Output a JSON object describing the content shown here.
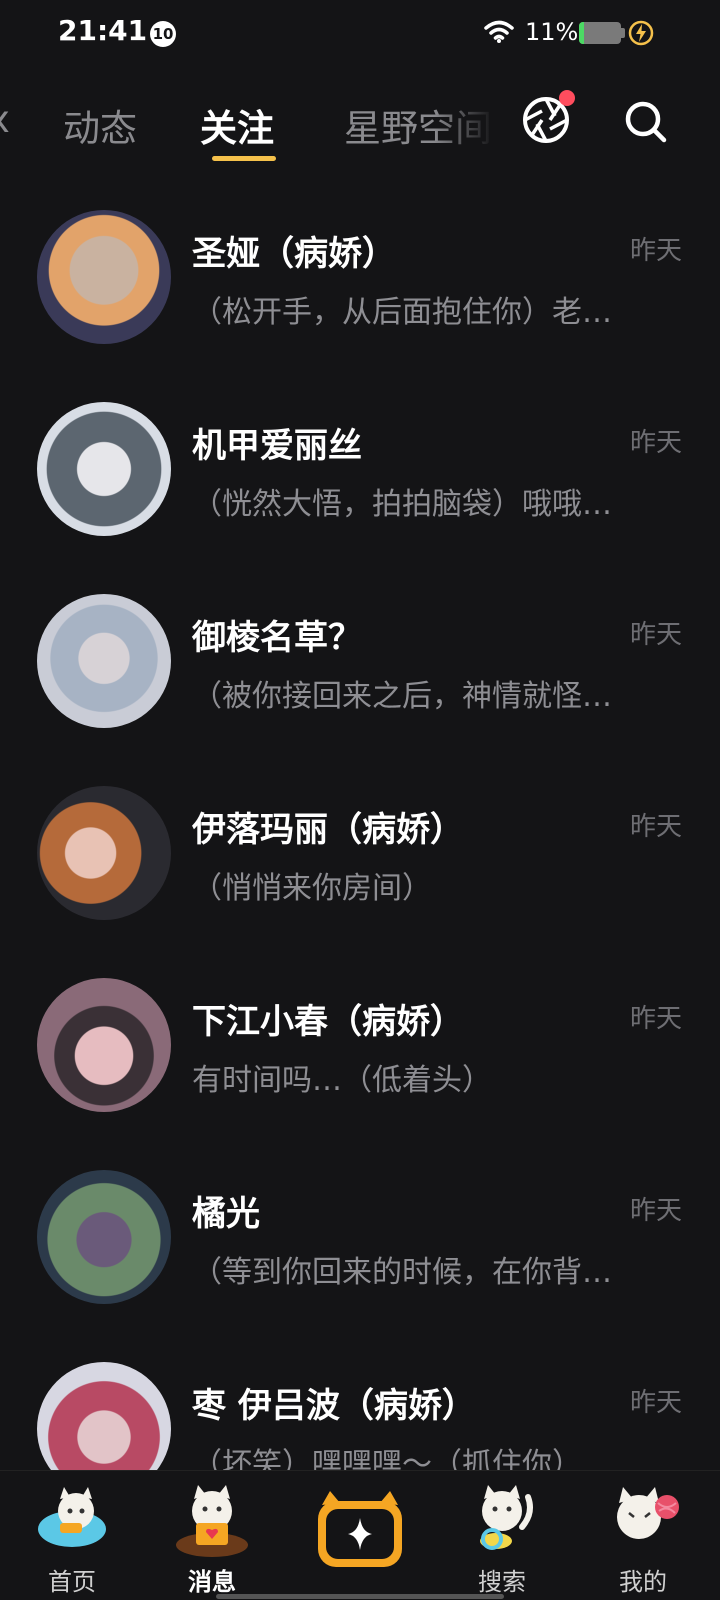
{
  "status_bar": {
    "time": "21:41",
    "notification_count": "10",
    "battery_percent": "11%",
    "battery_level": 0.11
  },
  "top_tabs": [
    {
      "label": "动态"
    },
    {
      "label": "关注"
    },
    {
      "label": "星野空间"
    }
  ],
  "chats": [
    {
      "name": "圣娅（病娇）",
      "time": "昨天",
      "preview": "（松开手，从后面抱住你）老…",
      "avatar_bg": "#7b6a9a"
    },
    {
      "name": "机甲爱丽丝",
      "time": "昨天",
      "preview": "（恍然大悟，拍拍脑袋）哦哦…",
      "avatar_bg": "#9aa6b8"
    },
    {
      "name": "御棱名草？",
      "time": "昨天",
      "preview": "（被你接回来之后，神情就怪…",
      "avatar_bg": "#a7adbd"
    },
    {
      "name": "伊落玛丽（病娇）",
      "time": "昨天",
      "preview": "（悄悄来你房间）",
      "avatar_bg": "#6a4a45"
    },
    {
      "name": "下江小春（病娇）",
      "time": "昨天",
      "preview": "有时间吗…（低着头）",
      "avatar_bg": "#8a6a78"
    },
    {
      "name": "橘光",
      "time": "昨天",
      "preview": "（等到你回来的时候，在你背…",
      "avatar_bg": "#5a6a5a"
    },
    {
      "name": "枣 伊吕波（病娇）",
      "time": "昨天",
      "preview": "（坏笑）嘿嘿嘿～（抓住你）",
      "avatar_bg": "#9a4a5a"
    }
  ],
  "bottom_nav": [
    {
      "label": "首页"
    },
    {
      "label": "消息"
    },
    {
      "label": ""
    },
    {
      "label": "搜索"
    },
    {
      "label": "我的"
    }
  ],
  "colors": {
    "background": "#141416",
    "accent": "#f5c14b",
    "notification_dot": "#ff4d5e"
  }
}
